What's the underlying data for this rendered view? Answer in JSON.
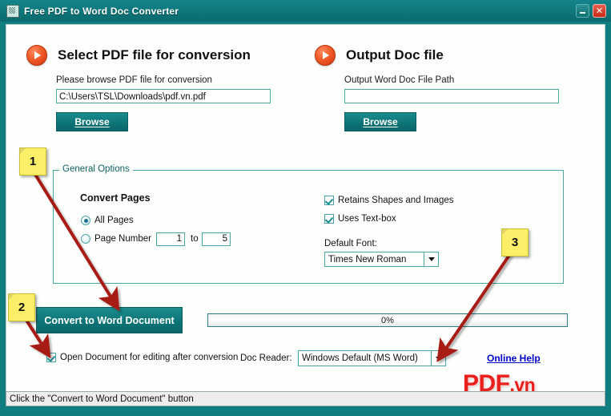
{
  "window": {
    "title": "Free PDF to Word Doc Converter",
    "icon": "app-icon",
    "minimize_label": "minimize",
    "close_label": "close"
  },
  "left_section": {
    "bullet_icon": "orange-play-bullet",
    "title": "Select PDF file for conversion",
    "subtitle": "Please browse PDF file for conversion",
    "input_value": "C:\\Users\\TSL\\Downloads\\pdf.vn.pdf",
    "input_placeholder": "",
    "browse_label": "Browse"
  },
  "right_section": {
    "bullet_icon": "orange-play-bullet",
    "title": "Output Doc file",
    "subtitle": "Output Word Doc File Path",
    "input_value": "",
    "input_placeholder": "",
    "browse_label": "Browse"
  },
  "general_options": {
    "group_label": "General Options",
    "convert_pages_title": "Convert Pages",
    "radio_all_pages": "All Pages",
    "radio_page_number": "Page Number",
    "page_from": "1",
    "to_label": "to",
    "page_to": "5",
    "check_retains_shapes": "Retains Shapes and Images",
    "check_uses_textbox": "Uses Text-box",
    "default_font_label": "Default Font:",
    "default_font_value": "Times New Roman"
  },
  "actions": {
    "convert_label": "Convert to Word Document",
    "progress_text": "0%",
    "progress_percent": 0,
    "open_document_label": "Open Document for editing after conversion",
    "doc_reader_label": "Doc Reader:",
    "doc_reader_value": "Windows Default (MS Word)",
    "online_help_label": "Online Help"
  },
  "logo": {
    "main": "PDF",
    "suffix": ".vn"
  },
  "statusbar": {
    "text": "Click the \"Convert to Word Document\" button"
  },
  "annotations": [
    {
      "number": "1",
      "points_to": "convert-to-word-document-button"
    },
    {
      "number": "2",
      "points_to": "open-document-checkbox"
    },
    {
      "number": "3",
      "points_to": "doc-reader-dropdown"
    }
  ],
  "colors": {
    "window_chrome": "#107d81",
    "accent_teal": "#0e7578",
    "bullet_orange": "#f05a28",
    "link_blue": "#0000cc",
    "note_yellow": "#fbef6a",
    "arrow_red": "#a81d17",
    "logo_red": "#e8201c"
  }
}
